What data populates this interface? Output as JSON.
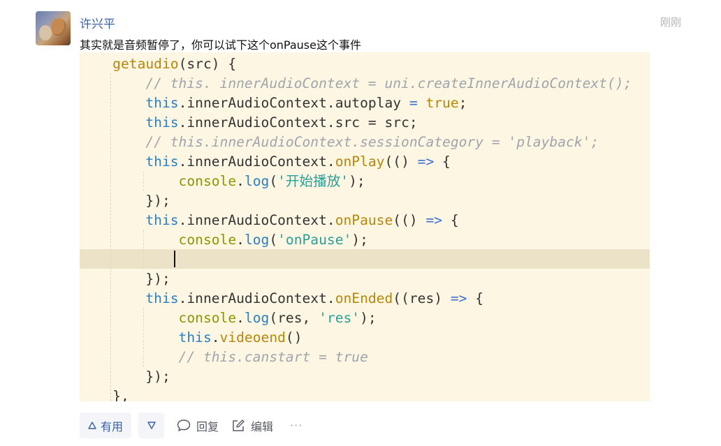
{
  "user": {
    "name": "许兴平"
  },
  "timestamp": "刚刚",
  "message": "其实就是音频暂停了，你可以试下这个onPause这个事件",
  "code_lines": [
    [
      [
        "fn",
        "    getaudio"
      ],
      [
        "txt",
        "(src) {"
      ]
    ],
    [
      [
        "cm",
        "        // this. innerAudioContext = uni.createInnerAudioContext();"
      ]
    ],
    [
      [
        "kw",
        "        this"
      ],
      [
        "txt",
        ".innerAudioContext.autoplay "
      ],
      [
        "op",
        "="
      ],
      [
        "txt",
        " "
      ],
      [
        "bool",
        "true"
      ],
      [
        "txt",
        ";"
      ]
    ],
    [
      [
        "kw",
        "        this"
      ],
      [
        "txt",
        ".innerAudioContext.src = src;"
      ]
    ],
    [
      [
        "cm",
        "        // this.innerAudioContext.sessionCategory = 'playback';"
      ]
    ],
    [
      [
        "kw",
        "        this"
      ],
      [
        "txt",
        ".innerAudioContext."
      ],
      [
        "fn",
        "onPlay"
      ],
      [
        "txt",
        "(() "
      ],
      [
        "op",
        "=>"
      ],
      [
        "txt",
        " {"
      ]
    ],
    [
      [
        "con",
        "            console"
      ],
      [
        "txt",
        "."
      ],
      [
        "kw",
        "log"
      ],
      [
        "txt",
        "("
      ],
      [
        "str",
        "'开始播放'"
      ],
      [
        "txt",
        ");"
      ]
    ],
    [
      [
        "txt",
        "        });"
      ]
    ],
    [
      [
        "kw",
        "        this"
      ],
      [
        "txt",
        ".innerAudioContext."
      ],
      [
        "fn",
        "onPause"
      ],
      [
        "txt",
        "(() "
      ],
      [
        "op",
        "=>"
      ],
      [
        "txt",
        " {"
      ]
    ],
    [
      [
        "con",
        "            console"
      ],
      [
        "txt",
        "."
      ],
      [
        "kw",
        "log"
      ],
      [
        "txt",
        "("
      ],
      [
        "str",
        "'onPause'"
      ],
      [
        "txt",
        ");"
      ]
    ],
    [
      [
        "txt",
        ""
      ]
    ],
    [
      [
        "txt",
        "        });"
      ]
    ],
    [
      [
        "kw",
        "        this"
      ],
      [
        "txt",
        ".innerAudioContext."
      ],
      [
        "fn",
        "onEnded"
      ],
      [
        "txt",
        "((res) "
      ],
      [
        "op",
        "=>"
      ],
      [
        "txt",
        " {"
      ]
    ],
    [
      [
        "con",
        "            console"
      ],
      [
        "txt",
        "."
      ],
      [
        "kw",
        "log"
      ],
      [
        "txt",
        "(res, "
      ],
      [
        "str",
        "'res'"
      ],
      [
        "txt",
        ");"
      ]
    ],
    [
      [
        "kw",
        "            this"
      ],
      [
        "txt",
        "."
      ],
      [
        "fn",
        "videoend"
      ],
      [
        "txt",
        "()"
      ]
    ],
    [
      [
        "cm",
        "            // this.canstart = true"
      ]
    ],
    [
      [
        "txt",
        "        });"
      ]
    ],
    [
      [
        "txt",
        "    },"
      ]
    ]
  ],
  "actions": {
    "useful_label": "有用",
    "reply_label": "回复",
    "edit_label": "编辑",
    "more_label": "···"
  },
  "colors": {
    "link": "#3b5ea8",
    "code_bg": "#fdf6e3",
    "current_line": "#ebe2c8"
  }
}
